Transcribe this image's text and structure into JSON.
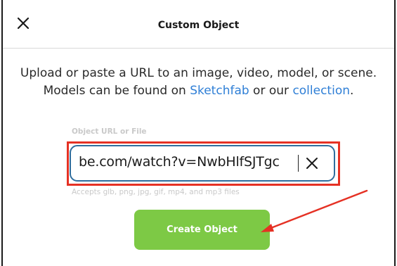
{
  "header": {
    "title": "Custom Object",
    "close_icon": "close-icon"
  },
  "description": {
    "text_before": "Upload or paste a URL to an image, video, model, or scene. Models can be found on ",
    "sketchfab_link": "Sketchfab",
    "text_middle": " or our ",
    "collection_link": "collection",
    "text_after": "."
  },
  "url_field": {
    "label": "Object URL or File",
    "value": "be.com/watch?v=NwbHlfSJTgc",
    "clear_icon": "clear-icon",
    "hint": "Accepts glb, png, jpg, gif, mp4, and mp3 files"
  },
  "actions": {
    "create_label": "Create Object"
  },
  "colors": {
    "accent_green": "#7dc945",
    "link_blue": "#2f7fd6",
    "input_border": "#2f6e9e",
    "annotation_red": "#e53124"
  }
}
